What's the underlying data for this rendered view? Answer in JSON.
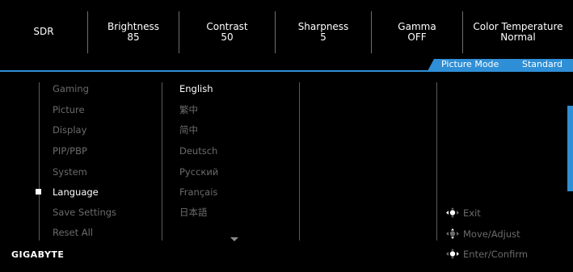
{
  "top_bar": [
    {
      "title": "SDR",
      "value": ""
    },
    {
      "title": "Brightness",
      "value": "85"
    },
    {
      "title": "Contrast",
      "value": "50"
    },
    {
      "title": "Sharpness",
      "value": "5"
    },
    {
      "title": "Gamma",
      "value": "OFF"
    },
    {
      "title": "Color Temperature",
      "value": "Normal"
    }
  ],
  "status": {
    "label": "Picture Mode",
    "value": "Standard"
  },
  "main_menu": [
    "Gaming",
    "Picture",
    "Display",
    "PIP/PBP",
    "System",
    "Language",
    "Save Settings",
    "Reset All"
  ],
  "main_menu_active": "Language",
  "languages": [
    "English",
    "繁中",
    "简中",
    "Deutsch",
    "Русский",
    "Français",
    "日本語"
  ],
  "language_selected": "English",
  "hints": [
    {
      "label": "Exit",
      "icon": "joystick-left-icon"
    },
    {
      "label": "Move/Adjust",
      "icon": "joystick-updown-icon"
    },
    {
      "label": "Enter/Confirm",
      "icon": "joystick-press-icon"
    }
  ],
  "brand": "GIGABYTE",
  "colors": {
    "accent": "#2f8fd6",
    "inactive": "#6b6b6b",
    "active": "#ffffff"
  }
}
